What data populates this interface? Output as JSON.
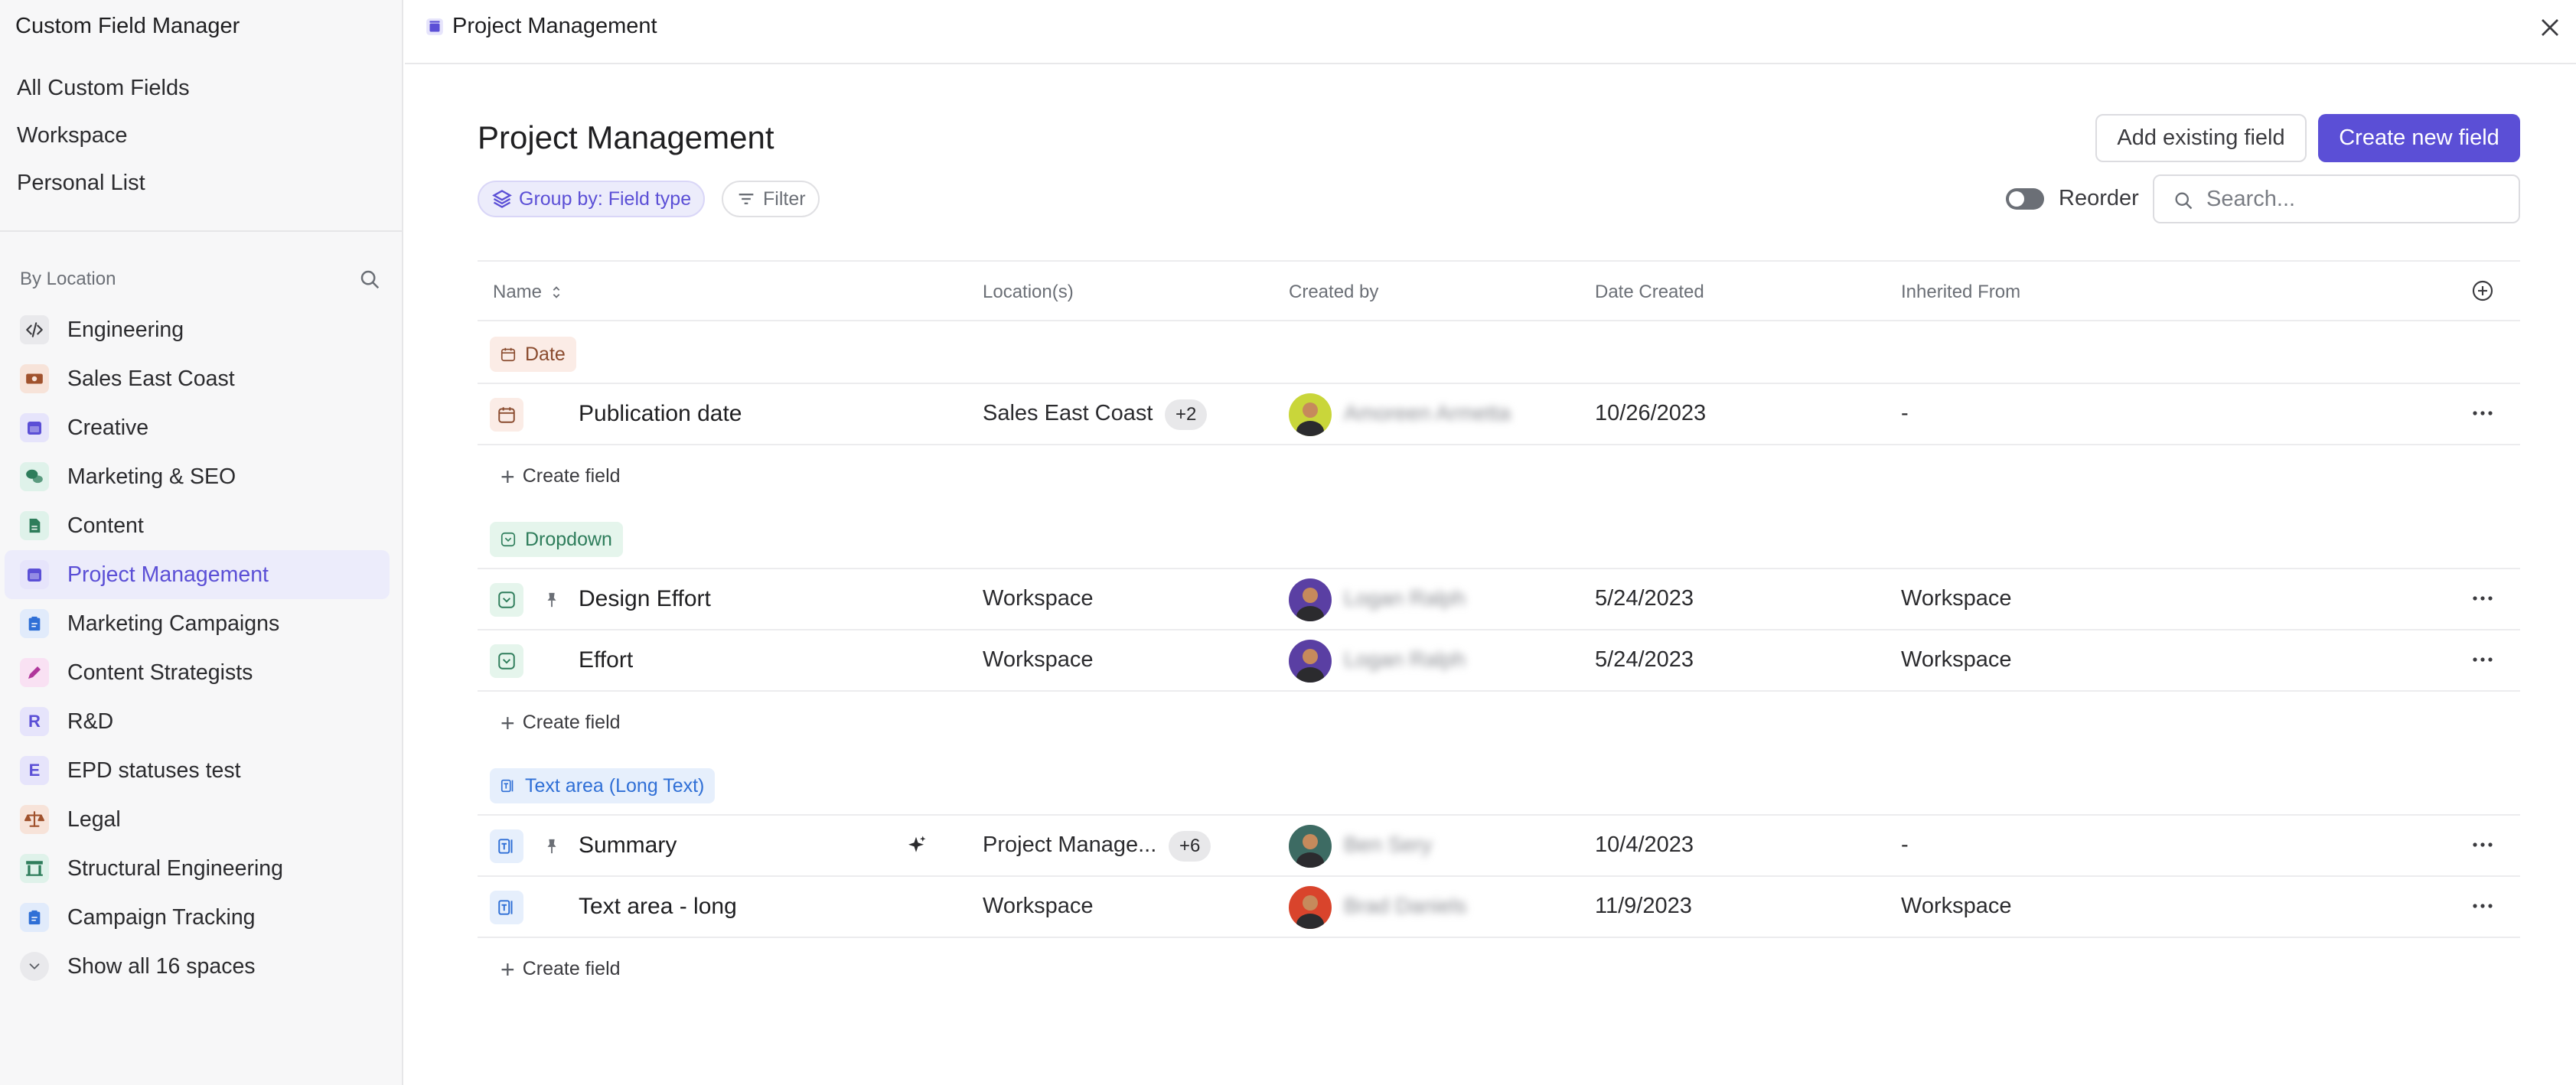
{
  "sidebar": {
    "title": "Custom Field Manager",
    "top_items": [
      "All Custom Fields",
      "Workspace",
      "Personal List"
    ],
    "section_label": "By Location",
    "spaces": [
      {
        "label": "Engineering",
        "icon": "code-icon",
        "bg": "#e9e9ec",
        "fg": "#3b3b3f"
      },
      {
        "label": "Sales East Coast",
        "icon": "money-icon",
        "bg": "#f7e3d9",
        "fg": "#a0522d"
      },
      {
        "label": "Creative",
        "icon": "calendar-icon",
        "bg": "#e6e4fb",
        "fg": "#5b4fd6"
      },
      {
        "label": "Marketing & SEO",
        "icon": "chat-icon",
        "bg": "#dff2ea",
        "fg": "#2e7d5b"
      },
      {
        "label": "Content",
        "icon": "document-icon",
        "bg": "#dff2ea",
        "fg": "#2e7d5b"
      },
      {
        "label": "Project Management",
        "icon": "calendar-icon",
        "bg": "#e6e4fb",
        "fg": "#5b4fd6",
        "active": true
      },
      {
        "label": "Marketing Campaigns",
        "icon": "clipboard-icon",
        "bg": "#e1ebfb",
        "fg": "#2f6fd6"
      },
      {
        "label": "Content Strategists",
        "icon": "pencil-icon",
        "bg": "#f9e1f3",
        "fg": "#b0379b"
      },
      {
        "label": "R&D",
        "icon": "letter-r-icon",
        "letter": "R",
        "bg": "#e6e4fb",
        "fg": "#5b4fd6"
      },
      {
        "label": "EPD statuses test",
        "icon": "letter-e-icon",
        "letter": "E",
        "bg": "#e6e4fb",
        "fg": "#5b4fd6"
      },
      {
        "label": "Legal",
        "icon": "scales-icon",
        "bg": "#f7e3d9",
        "fg": "#a0522d"
      },
      {
        "label": "Structural Engineering",
        "icon": "building-icon",
        "bg": "#dff2ea",
        "fg": "#2e7d5b"
      },
      {
        "label": "Campaign Tracking",
        "icon": "clipboard-icon",
        "bg": "#e1ebfb",
        "fg": "#2f6fd6"
      }
    ],
    "show_all": "Show all 16 spaces"
  },
  "topbar": {
    "title": "Project Management"
  },
  "header": {
    "title": "Project Management",
    "group_by": "Group by: Field type",
    "filter": "Filter",
    "add_existing": "Add existing field",
    "create_new": "Create new field",
    "reorder": "Reorder",
    "search_placeholder": "Search..."
  },
  "table": {
    "columns": {
      "name": "Name",
      "locations": "Location(s)",
      "created_by": "Created by",
      "date_created": "Date Created",
      "inherited_from": "Inherited From"
    },
    "create_field_label": "Create field",
    "groups": [
      {
        "label": "Date",
        "bg": "#fbece6",
        "fg": "#8a4b2e",
        "rows": [
          {
            "name": "Publication date",
            "pinned": false,
            "ai": false,
            "location": "Sales East Coast",
            "more": "+2",
            "created_by": "Amoreen Armetta",
            "avatar_bg": "#c9d63a",
            "date": "10/26/2023",
            "inherited": "-"
          }
        ]
      },
      {
        "label": "Dropdown",
        "bg": "#e5f5ec",
        "fg": "#2e7d5b",
        "rows": [
          {
            "name": "Design Effort",
            "pinned": true,
            "ai": false,
            "location": "Workspace",
            "more": "",
            "created_by": "Logan Ralph",
            "avatar_bg": "#5a3fa3",
            "date": "5/24/2023",
            "inherited": "Workspace"
          },
          {
            "name": "Effort",
            "pinned": false,
            "ai": false,
            "location": "Workspace",
            "more": "",
            "created_by": "Logan Ralph",
            "avatar_bg": "#5a3fa3",
            "date": "5/24/2023",
            "inherited": "Workspace"
          }
        ]
      },
      {
        "label": "Text area (Long Text)",
        "bg": "#e6effc",
        "fg": "#2f6fd6",
        "rows": [
          {
            "name": "Summary",
            "pinned": true,
            "ai": true,
            "location": "Project Manage...",
            "more": "+6",
            "created_by": "Ben Sery",
            "avatar_bg": "#3d6b63",
            "date": "10/4/2023",
            "inherited": "-"
          },
          {
            "name": "Text area - long",
            "pinned": false,
            "ai": false,
            "location": "Workspace",
            "more": "",
            "created_by": "Brad Daniels",
            "avatar_bg": "#d9442c",
            "date": "11/9/2023",
            "inherited": "Workspace"
          }
        ]
      }
    ]
  }
}
